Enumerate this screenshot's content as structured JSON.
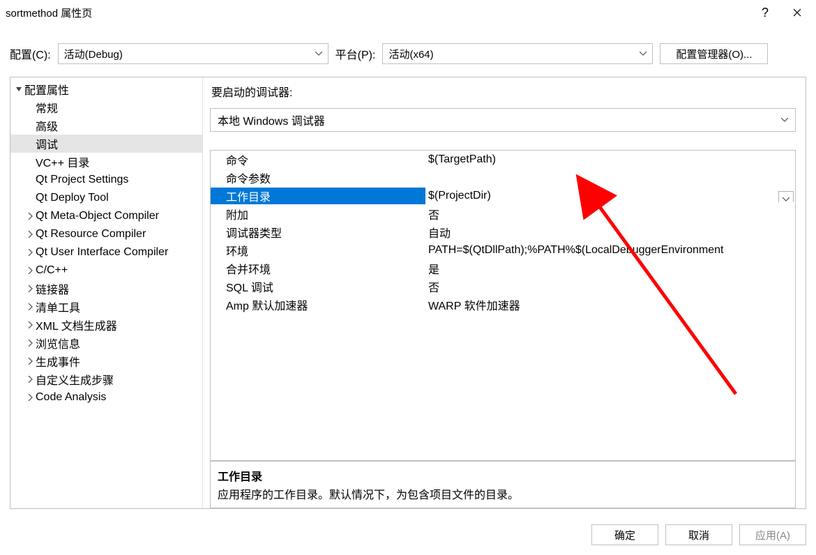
{
  "window": {
    "title": "sortmethod 属性页"
  },
  "top": {
    "config_label": "配置(C):",
    "config_value": "活动(Debug)",
    "platform_label": "平台(P):",
    "platform_value": "活动(x64)",
    "config_manager_label": "配置管理器(O)..."
  },
  "tree": {
    "items": [
      {
        "label": "配置属性",
        "depth": 0,
        "expandable": true,
        "expanded": true,
        "selected": false
      },
      {
        "label": "常规",
        "depth": 1,
        "expandable": false,
        "selected": false
      },
      {
        "label": "高级",
        "depth": 1,
        "expandable": false,
        "selected": false
      },
      {
        "label": "调试",
        "depth": 1,
        "expandable": false,
        "selected": true
      },
      {
        "label": "VC++ 目录",
        "depth": 1,
        "expandable": false,
        "selected": false
      },
      {
        "label": "Qt Project Settings",
        "depth": 1,
        "expandable": false,
        "selected": false
      },
      {
        "label": "Qt Deploy Tool",
        "depth": 1,
        "expandable": false,
        "selected": false
      },
      {
        "label": "Qt Meta-Object Compiler",
        "depth": 1,
        "expandable": true,
        "expanded": false,
        "selected": false
      },
      {
        "label": "Qt Resource Compiler",
        "depth": 1,
        "expandable": true,
        "expanded": false,
        "selected": false
      },
      {
        "label": "Qt User Interface Compiler",
        "depth": 1,
        "expandable": true,
        "expanded": false,
        "selected": false
      },
      {
        "label": "C/C++",
        "depth": 1,
        "expandable": true,
        "expanded": false,
        "selected": false
      },
      {
        "label": "链接器",
        "depth": 1,
        "expandable": true,
        "expanded": false,
        "selected": false
      },
      {
        "label": "清单工具",
        "depth": 1,
        "expandable": true,
        "expanded": false,
        "selected": false
      },
      {
        "label": "XML 文档生成器",
        "depth": 1,
        "expandable": true,
        "expanded": false,
        "selected": false
      },
      {
        "label": "浏览信息",
        "depth": 1,
        "expandable": true,
        "expanded": false,
        "selected": false
      },
      {
        "label": "生成事件",
        "depth": 1,
        "expandable": true,
        "expanded": false,
        "selected": false
      },
      {
        "label": "自定义生成步骤",
        "depth": 1,
        "expandable": true,
        "expanded": false,
        "selected": false
      },
      {
        "label": "Code Analysis",
        "depth": 1,
        "expandable": true,
        "expanded": false,
        "selected": false
      }
    ]
  },
  "right": {
    "debugger_to_launch_label": "要启动的调试器:",
    "debugger_selected": "本地 Windows 调试器",
    "props": [
      {
        "name": "命令",
        "value": "$(TargetPath)",
        "selected": false
      },
      {
        "name": "命令参数",
        "value": "",
        "selected": false
      },
      {
        "name": "工作目录",
        "value": "$(ProjectDir)",
        "selected": true
      },
      {
        "name": "附加",
        "value": "否",
        "selected": false
      },
      {
        "name": "调试器类型",
        "value": "自动",
        "selected": false
      },
      {
        "name": "环境",
        "value": "PATH=$(QtDllPath);%PATH%$(LocalDebuggerEnvironment",
        "selected": false
      },
      {
        "name": "合并环境",
        "value": "是",
        "selected": false
      },
      {
        "name": "SQL 调试",
        "value": "否",
        "selected": false
      },
      {
        "name": "Amp 默认加速器",
        "value": "WARP 软件加速器",
        "selected": false
      }
    ],
    "desc_title": "工作目录",
    "desc_body": "应用程序的工作目录。默认情况下，为包含项目文件的目录。"
  },
  "bottom": {
    "ok": "确定",
    "cancel": "取消",
    "apply": "应用(A)"
  }
}
